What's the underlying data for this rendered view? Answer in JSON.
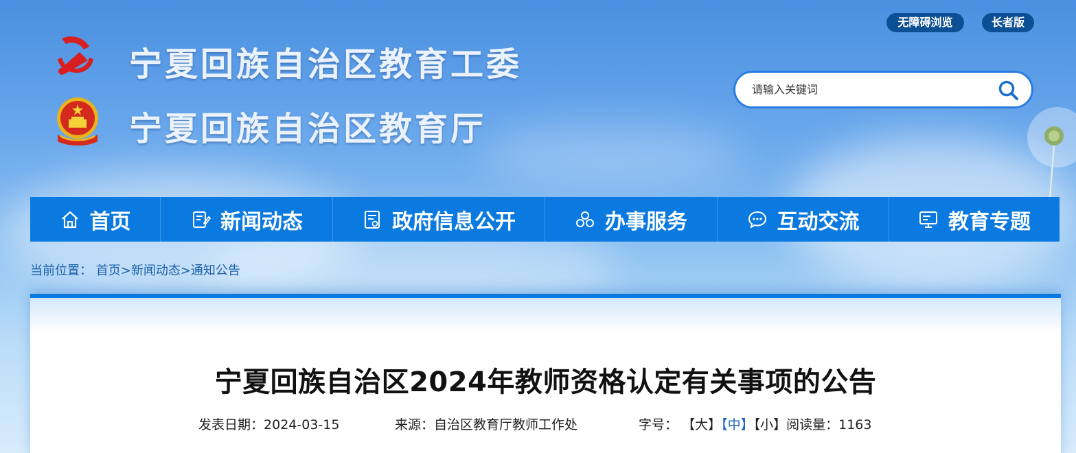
{
  "header": {
    "accessibility_label": "无障碍浏览",
    "elderly_label": "长者版",
    "org_title_1": "宁夏回族自治区教育工委",
    "org_title_2": "宁夏回族自治区教育厅"
  },
  "search": {
    "placeholder": "请输入关键词"
  },
  "nav": {
    "items": [
      {
        "label": "首页",
        "icon": "home-icon"
      },
      {
        "label": "新闻动态",
        "icon": "news-icon"
      },
      {
        "label": "政府信息公开",
        "icon": "document-icon"
      },
      {
        "label": "办事服务",
        "icon": "service-icon"
      },
      {
        "label": "互动交流",
        "icon": "chat-icon"
      },
      {
        "label": "教育专题",
        "icon": "monitor-icon"
      }
    ]
  },
  "breadcrumb": {
    "prefix": "当前位置：",
    "items": [
      "首页",
      "新闻动态",
      "通知公告"
    ],
    "separator": ">"
  },
  "article": {
    "title": "宁夏回族自治区2024年教师资格认定有关事项的公告",
    "date_label": "发表日期：",
    "date": "2024-03-15",
    "source_label": "来源：",
    "source": "自治区教育厅教师工作处",
    "font_size_label": "字号：",
    "size_large": "【大】",
    "size_medium": "【中】",
    "size_small": "【小】",
    "views_label": "阅读量：",
    "views": "1163"
  },
  "colors": {
    "nav_bg": "#0a7ae0",
    "quick_btn_bg": "#0d4f94",
    "link": "#1b5fa8",
    "active_size": "#1a66c2"
  }
}
